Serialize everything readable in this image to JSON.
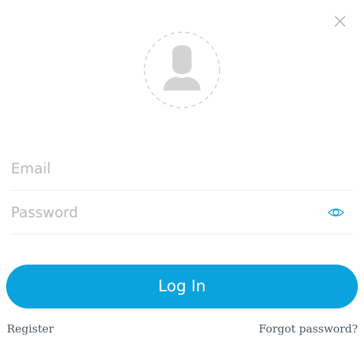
{
  "header": {
    "close_icon": "close-icon"
  },
  "avatar": {
    "icon": "user-silhouette-icon",
    "ring_style": "dashed"
  },
  "form": {
    "email": {
      "placeholder": "Email",
      "value": ""
    },
    "password": {
      "placeholder": "Password",
      "value": "",
      "toggle_icon": "eye-icon"
    },
    "login_label": "Log In"
  },
  "footer": {
    "register_label": "Register",
    "forgot_label": "Forgot password?"
  },
  "colors": {
    "accent": "#0ba3dd",
    "placeholder": "#b9b9b9",
    "link": "#4a5661",
    "icon_gray": "#d2d2d2",
    "divider": "#ececec"
  }
}
